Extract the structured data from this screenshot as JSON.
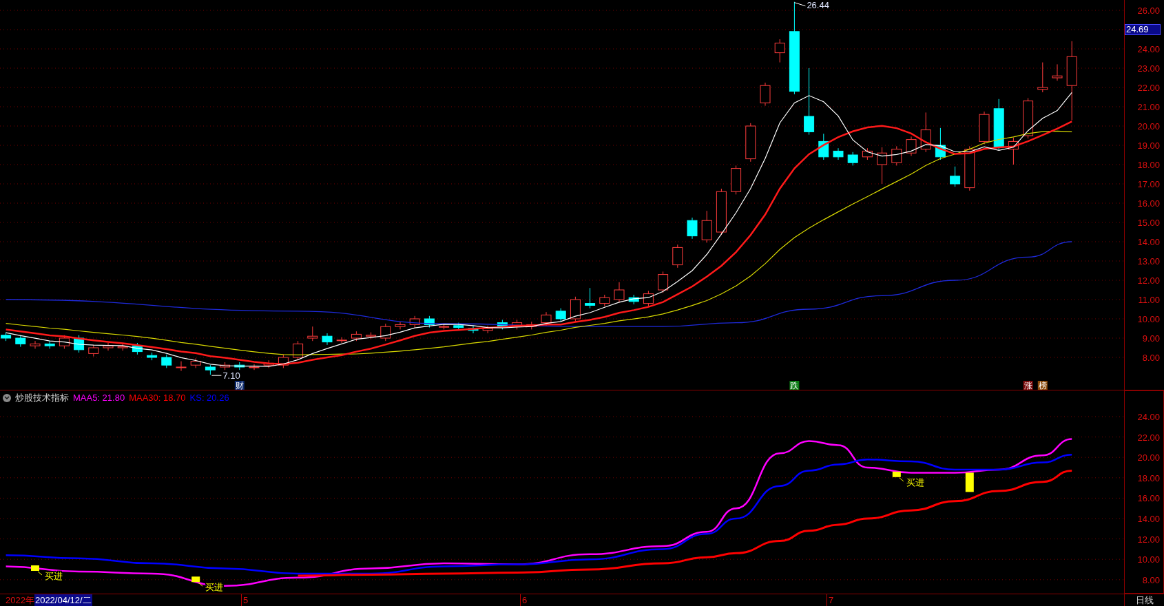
{
  "price_chart": {
    "axis_labels": [
      "26.00",
      "24.00",
      "23.00",
      "22.00",
      "21.00",
      "20.00",
      "19.00",
      "18.00",
      "17.00",
      "16.00",
      "15.00",
      "14.00",
      "13.00",
      "12.00",
      "11.00",
      "10.00",
      "9.00",
      "8.00"
    ],
    "current_price": "24.69",
    "high_label": "26.44",
    "low_label": "7.10",
    "tags": [
      {
        "text": "财",
        "color": "#0c2a6e"
      },
      {
        "text": "跌",
        "color": "#0a7a12"
      },
      {
        "text": "涨",
        "color": "#7a0a0a"
      },
      {
        "text": "榜",
        "color": "#8a4a0a"
      }
    ]
  },
  "indicator": {
    "title": "炒股技术指标",
    "legend": [
      {
        "text": "MAA5: 21.80",
        "color": "#ff00ff"
      },
      {
        "text": "MAA30: 18.70",
        "color": "#ff0000"
      },
      {
        "text": "KS: 20.26",
        "color": "#0000ff"
      }
    ],
    "signals": [
      {
        "kind": "flag",
        "label": "买进"
      },
      {
        "kind": "flag",
        "label": "买进"
      },
      {
        "kind": "flag",
        "label": "买进"
      },
      {
        "kind": "bar"
      }
    ],
    "axis_labels": [
      "24.00",
      "22.00",
      "20.00",
      "18.00",
      "16.00",
      "14.00",
      "12.00",
      "10.00",
      "8.00"
    ]
  },
  "time_bar": {
    "year": "2022年",
    "cursor_date": "2022/04/12/二",
    "months": [
      "5",
      "6",
      "7"
    ],
    "period": "日线"
  }
}
